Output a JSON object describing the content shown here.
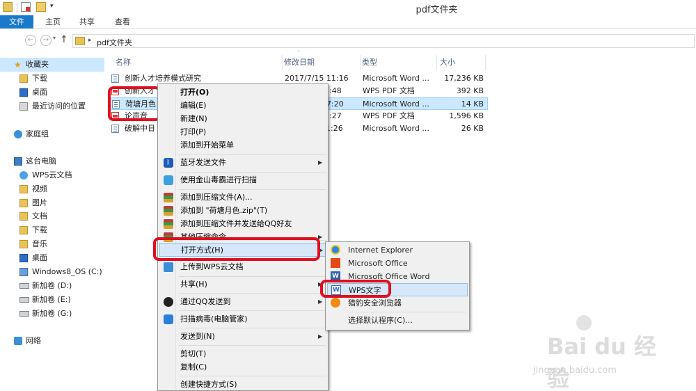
{
  "window": {
    "title": "pdf文件夹"
  },
  "ribbon": {
    "tabs": [
      "文件",
      "主页",
      "共享",
      "查看"
    ]
  },
  "address": {
    "path": "pdf文件夹"
  },
  "nav": {
    "items": [
      {
        "label": "收藏夹",
        "icon": "star-icon"
      },
      {
        "label": "下载",
        "icon": "downloads-folder-icon"
      },
      {
        "label": "桌面",
        "icon": "desktop-icon"
      },
      {
        "label": "最近访问的位置",
        "icon": "recent-places-icon"
      },
      {
        "label": "家庭组",
        "icon": "homegroup-icon"
      },
      {
        "label": "这台电脑",
        "icon": "computer-icon"
      },
      {
        "label": "WPS云文档",
        "icon": "cloud-icon"
      },
      {
        "label": "视频",
        "icon": "videos-folder-icon"
      },
      {
        "label": "图片",
        "icon": "pictures-folder-icon"
      },
      {
        "label": "文档",
        "icon": "documents-folder-icon"
      },
      {
        "label": "下载",
        "icon": "downloads-folder-icon"
      },
      {
        "label": "音乐",
        "icon": "music-folder-icon"
      },
      {
        "label": "桌面",
        "icon": "desktop-icon"
      },
      {
        "label": "Windows8_OS (C:)",
        "icon": "system-drive-icon"
      },
      {
        "label": "新加卷 (D:)",
        "icon": "drive-icon"
      },
      {
        "label": "新加卷 (E:)",
        "icon": "drive-icon"
      },
      {
        "label": "新加卷 (G:)",
        "icon": "drive-icon"
      },
      {
        "label": "网络",
        "icon": "network-icon"
      }
    ]
  },
  "columns": {
    "name": "名称",
    "date": "修改日期",
    "type": "类型",
    "size": "大小"
  },
  "files": [
    {
      "name": "创新人才培养模式研究",
      "date": "2017/7/15 11:16",
      "type": "Microsoft Word ...",
      "size": "17,236 KB",
      "icon": "word-doc-icon"
    },
    {
      "name": "创新人才",
      "date": ":48",
      "type": "WPS PDF 文档",
      "size": "392 KB",
      "icon": "pdf-icon"
    },
    {
      "name": "荷塘月色",
      "date": "7:20",
      "type": "Microsoft Word ...",
      "size": "14 KB",
      "icon": "word-doc-icon"
    },
    {
      "name": "论声音",
      "date": ":27",
      "type": "WPS PDF 文档",
      "size": "1,596 KB",
      "icon": "pdf-icon"
    },
    {
      "name": "破解中日",
      "date": "1:26",
      "type": "Microsoft Word ...",
      "size": "26 KB",
      "icon": "word-doc-icon"
    }
  ],
  "context_menu": {
    "open": "打开(O)",
    "edit": "编辑(E)",
    "new": "新建(N)",
    "print": "打印(P)",
    "pin_start": "添加到开始菜单",
    "bluetooth": "蓝牙发送文件",
    "kingsoft_scan": "使用金山毒霸进行扫描",
    "add_archive": "添加到压缩文件(A)...",
    "add_zip": "添加到 \"荷塘月色.zip\"(T)",
    "zip_qq": "添加到压缩文件并发送给QQ好友",
    "other_zip": "其他压缩命令",
    "open_with": "打开方式(H)",
    "upload_wps": "上传到WPS云文档",
    "share": "共享(H)",
    "send_qq": "通过QQ发送到",
    "scan_virus": "扫描病毒(电脑管家)",
    "send_to": "发送到(N)",
    "cut": "剪切(T)",
    "copy": "复制(C)",
    "shortcut": "创建快捷方式(S)"
  },
  "open_with_menu": {
    "ie": "Internet Explorer",
    "office": "Microsoft Office",
    "word": "Microsoft Office Word",
    "wps": "WPS文字",
    "leopard": "猎豹安全浏览器",
    "choose_default": "选择默认程序(C)..."
  },
  "watermark": {
    "brand": "Bai du 经验",
    "url": "jingyan.baidu.com"
  },
  "colors": {
    "accent": "#1979ca",
    "selection": "#cce8ff",
    "annotation": "#e00f1e"
  }
}
